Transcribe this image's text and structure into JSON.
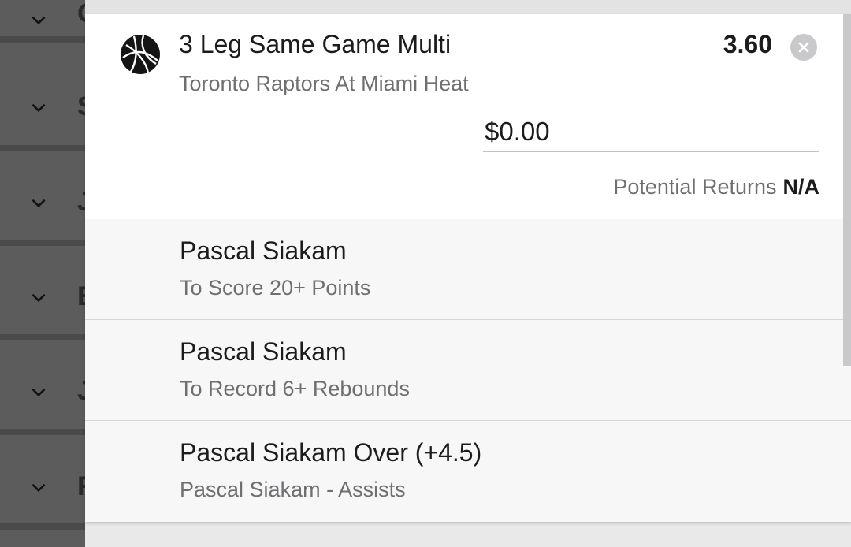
{
  "background_list": {
    "rows": [
      {
        "letter": "C"
      },
      {
        "letter": "S"
      },
      {
        "letter": "J"
      },
      {
        "letter": "E"
      },
      {
        "letter": "J"
      },
      {
        "letter": "R"
      }
    ]
  },
  "bet": {
    "icon": "basketball-icon",
    "title": "3 Leg Same Game Multi",
    "event": "Toronto Raptors At Miami Heat",
    "odds": "3.60",
    "stake_value": "$0.00",
    "potential_returns_label": "Potential Returns",
    "potential_returns_value": "N/A"
  },
  "legs": [
    {
      "name": "Pascal Siakam",
      "description": "To Score 20+ Points"
    },
    {
      "name": "Pascal Siakam",
      "description": "To Record 6+ Rebounds"
    },
    {
      "name": "Pascal Siakam Over (+4.5)",
      "description": "Pascal Siakam - Assists"
    }
  ],
  "colors": {
    "overlay": "#5c5c5c",
    "card": "#ffffff",
    "leg_background": "#f7f7f8",
    "secondary_text": "#6f6f72"
  }
}
